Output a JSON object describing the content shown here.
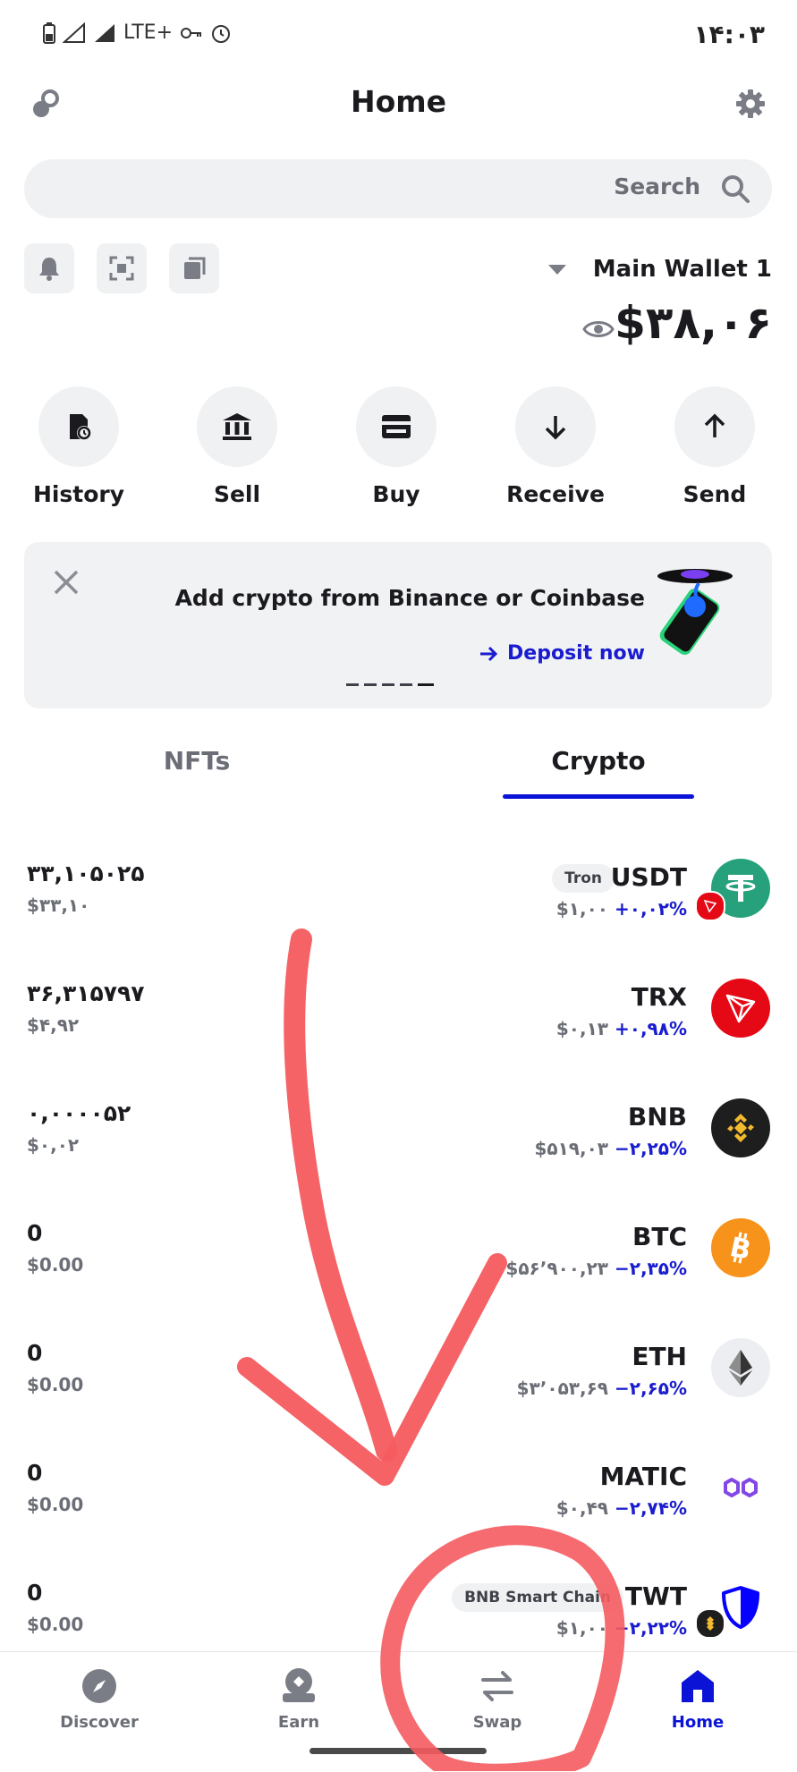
{
  "status_bar": {
    "network": "LTE+",
    "time": "۱۴:۰۳"
  },
  "header": {
    "title": "Home"
  },
  "search": {
    "placeholder": "Search"
  },
  "wallet": {
    "name": "Main Wallet 1",
    "balance": "$۳۸,۰۶"
  },
  "actions": [
    {
      "label": "History",
      "icon": "history-icon"
    },
    {
      "label": "Sell",
      "icon": "bank-icon"
    },
    {
      "label": "Buy",
      "icon": "card-icon"
    },
    {
      "label": "Receive",
      "icon": "arrow-down-icon"
    },
    {
      "label": "Send",
      "icon": "arrow-up-icon"
    }
  ],
  "banner": {
    "title": "Add crypto from Binance or Coinbase",
    "link": "Deposit now"
  },
  "tabs": [
    {
      "label": "NFTs"
    },
    {
      "label": "Crypto",
      "active": true
    }
  ],
  "tokens": [
    {
      "symbol": "USDT",
      "chain": "Tron",
      "price": "$۱,۰۰",
      "change": "+۰,۰۲%",
      "amount": "۳۳,۱۰۵۰۲۵",
      "fiat": "$۳۳,۱۰",
      "color": "#26a17b"
    },
    {
      "symbol": "TRX",
      "price": "$۰,۱۳",
      "change": "+۰,۹۸%",
      "amount": "۳۶,۳۱۵۷۹۷",
      "fiat": "$۴,۹۲",
      "color": "#e50915"
    },
    {
      "symbol": "BNB",
      "price": "$۵۱۹,۰۳",
      "change": "−۲,۲۵%",
      "amount": "۰,۰۰۰۰۵۲",
      "fiat": "$۰,۰۲",
      "color": "#1e1e1e"
    },
    {
      "symbol": "BTC",
      "price": "$۵۶٬۹۰۰,۲۳",
      "change": "−۲,۳۵%",
      "amount": "0",
      "fiat": "$0.00",
      "color": "#f7931a"
    },
    {
      "symbol": "ETH",
      "price": "$۳٬۰۵۳,۶۹",
      "change": "−۲,۶۵%",
      "amount": "0",
      "fiat": "$0.00",
      "color": "#eceef2"
    },
    {
      "symbol": "MATIC",
      "price": "$۰,۴۹",
      "change": "−۲,۷۴%",
      "amount": "0",
      "fiat": "$0.00",
      "color": "#ffffff"
    },
    {
      "symbol": "TWT",
      "chain": "BNB Smart Chain",
      "price": "$۱,۰۰",
      "change": "−۲,۲۲%",
      "amount": "0",
      "fiat": "$0.00",
      "color": "#ffffff"
    }
  ],
  "bottom_nav": [
    {
      "label": "Discover",
      "icon": "compass-icon"
    },
    {
      "label": "Earn",
      "icon": "earn-icon"
    },
    {
      "label": "Swap",
      "icon": "swap-icon"
    },
    {
      "label": "Home",
      "icon": "home-icon",
      "active": true
    }
  ],
  "colors": {
    "accent": "#0b13d6",
    "annotation": "#f45b5f"
  }
}
